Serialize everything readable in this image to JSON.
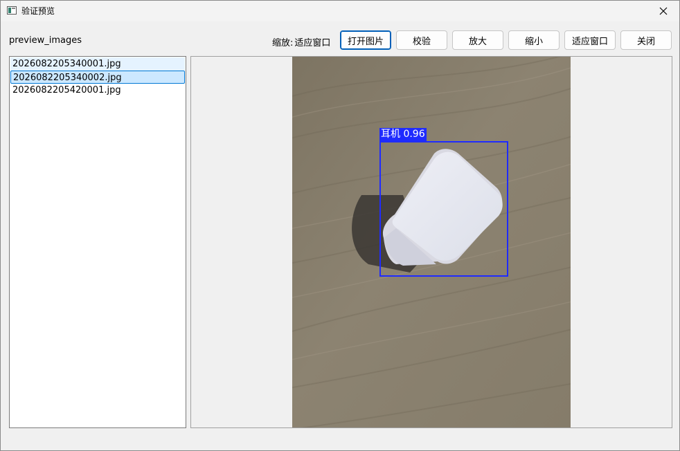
{
  "window": {
    "title": "验证预览",
    "icon": "app-window-icon",
    "close_icon": "close-icon"
  },
  "toolbar": {
    "folder_label": "preview_images",
    "zoom_prefix": "缩放:",
    "zoom_value": "适应窗口",
    "open_image": "打开图片",
    "verify": "校验",
    "zoom_in": "放大",
    "zoom_out": "缩小",
    "fit_window": "适应窗口",
    "close": "关闭"
  },
  "files": [
    {
      "name": "2026082205340001.jpg",
      "state": "hover"
    },
    {
      "name": "2026082205340002.jpg",
      "state": "selected"
    },
    {
      "name": "2026082205420001.jpg",
      "state": "normal"
    }
  ],
  "detection": {
    "label": "耳机 0.96",
    "box_color": "#1f2bff"
  },
  "colors": {
    "accent": "#005fb8",
    "selection_bg": "#cce8ff",
    "selection_border": "#0078d4",
    "hover_bg": "#e5f3ff"
  }
}
